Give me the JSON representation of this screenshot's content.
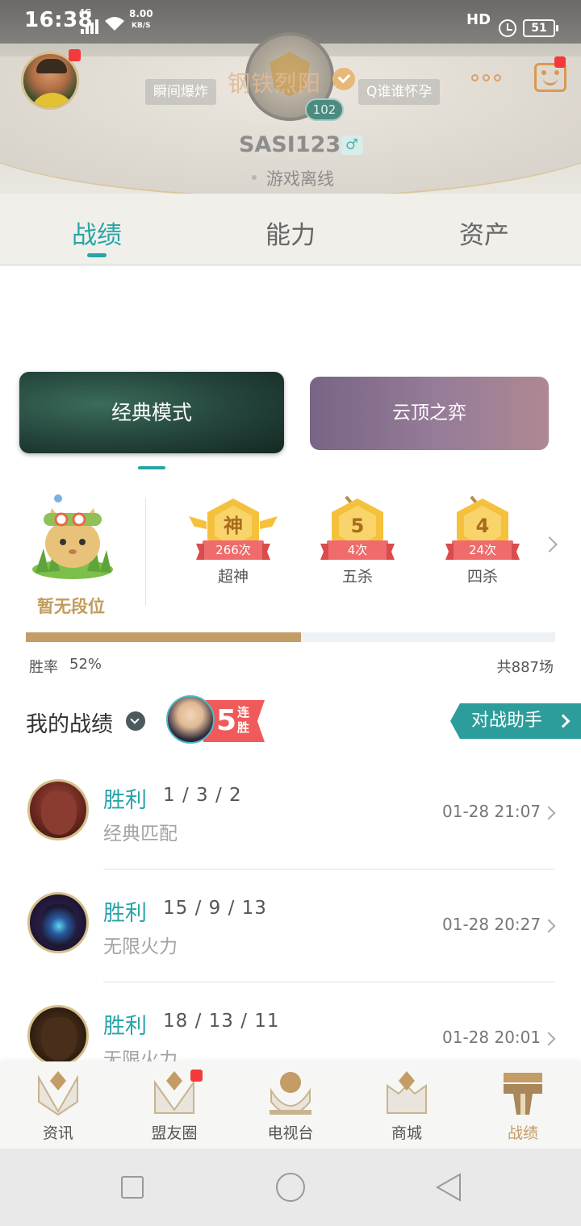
{
  "status_bar": {
    "time": "16:38",
    "network": "4G",
    "speed_value": "8.00",
    "speed_unit": "KB/S",
    "hd": "HD",
    "battery": "51"
  },
  "profile": {
    "rank_name": "钢铁烈阳",
    "level": "102",
    "tag_left": "瞬间爆炸",
    "tag_right": "Q谁谁怀孕",
    "username": "SASI123",
    "gender_symbol": "♂",
    "status": "游戏离线"
  },
  "tabs": [
    {
      "label": "战绩",
      "active": true
    },
    {
      "label": "能力",
      "active": false
    },
    {
      "label": "资产",
      "active": false
    }
  ],
  "modes": [
    {
      "label": "经典模式",
      "active": true
    },
    {
      "label": "云顶之弈",
      "active": false
    }
  ],
  "rank": {
    "status": "暂无段位"
  },
  "badges": [
    {
      "icon_char": "神",
      "count": "266次",
      "label": "超神"
    },
    {
      "icon_char": "5",
      "count": "4次",
      "label": "五杀"
    },
    {
      "icon_char": "4",
      "count": "24次",
      "label": "四杀"
    }
  ],
  "stats": {
    "winrate_label": "胜率",
    "winrate_value": "52%",
    "winrate_fraction": 0.52,
    "total_games": "共887场"
  },
  "records": {
    "title": "我的战绩",
    "streak_num": "5",
    "streak_text": "连胜",
    "assistant_label": "对战助手"
  },
  "matches": [
    {
      "result": "胜利",
      "kda": "1 / 3 / 2",
      "mode": "经典匹配",
      "time": "01-28 21:07"
    },
    {
      "result": "胜利",
      "kda": "15 / 9 / 13",
      "mode": "无限火力",
      "time": "01-28 20:27"
    },
    {
      "result": "胜利",
      "kda": "18 / 13 / 11",
      "mode": "无限火力",
      "time": "01-28 20:01"
    }
  ],
  "bottom_nav": [
    {
      "label": "资讯",
      "active": false
    },
    {
      "label": "盟友圈",
      "active": false
    },
    {
      "label": "电视台",
      "active": false
    },
    {
      "label": "商城",
      "active": false
    },
    {
      "label": "战绩",
      "active": true
    }
  ],
  "colors": {
    "accent": "#27a5a8",
    "gold": "#c49c66",
    "badge_red": "#f06b6b",
    "notify_red": "#f23a3a"
  }
}
